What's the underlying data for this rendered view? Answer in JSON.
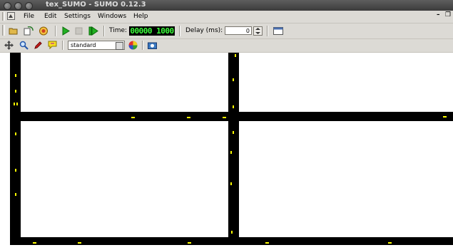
{
  "window": {
    "title": "tex_SUMO - SUMO 0.12.3",
    "controls": [
      "close-icon",
      "minimize-icon",
      "maximize-icon"
    ]
  },
  "menu": {
    "items": [
      "File",
      "Edit",
      "Settings",
      "Windows",
      "Help"
    ],
    "right_controls": [
      "minimize-icon",
      "restore-icon"
    ]
  },
  "toolbar": {
    "icons": [
      "open-folder-icon",
      "reload-icon",
      "close-simulation-icon",
      "play-icon",
      "stop-icon",
      "step-icon"
    ],
    "time_label": "Time:",
    "time_value": "00000 1000",
    "delay_label": "Delay (ms):",
    "delay_value": "0",
    "new_view_icon": "new-view-icon"
  },
  "viewbar": {
    "icons": [
      "recenter-icon",
      "locate-icon",
      "edit-icon",
      "tooltip-icon"
    ],
    "scheme_value": "standard",
    "color_icon": "color-wheel-icon",
    "screenshot_icon": "camera-icon"
  },
  "colors": {
    "road": "#000000",
    "vehicle": "#ffff00",
    "background": "#ffffff",
    "lcd": "#3cff3c"
  }
}
